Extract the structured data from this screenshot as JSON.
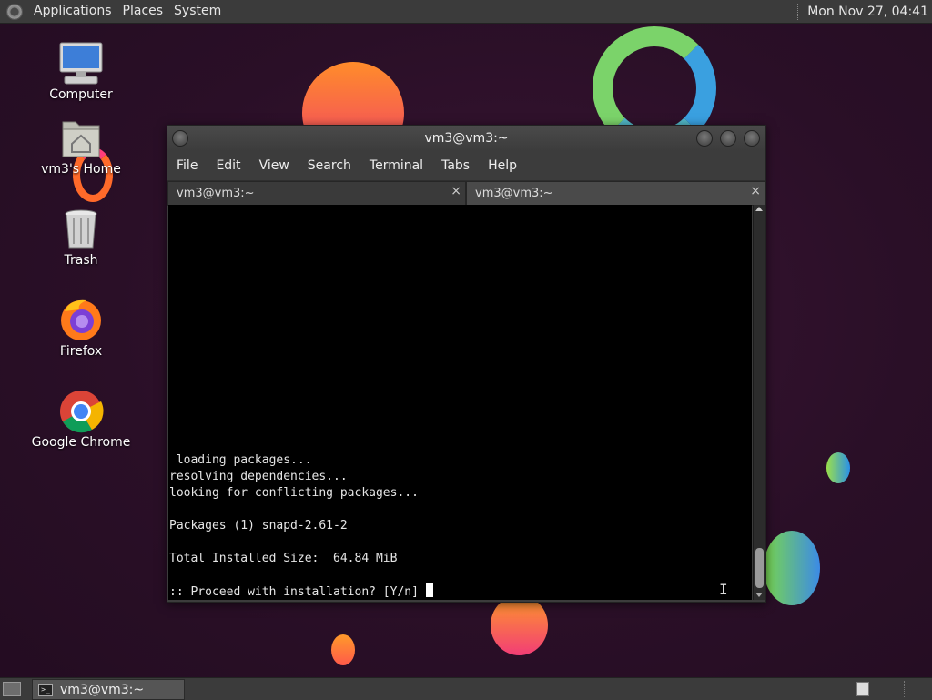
{
  "top_panel": {
    "menus": [
      "Applications",
      "Places",
      "System"
    ],
    "clock": "Mon Nov 27, 04:41"
  },
  "desktop": {
    "icons": [
      {
        "label": "Computer",
        "icon": "computer-icon"
      },
      {
        "label": "vm3's Home",
        "icon": "home-folder-icon"
      },
      {
        "label": "Trash",
        "icon": "trash-icon"
      },
      {
        "label": "Firefox",
        "icon": "firefox-icon"
      },
      {
        "label": "Google Chrome",
        "icon": "chrome-icon"
      }
    ]
  },
  "window": {
    "title": "vm3@vm3:~",
    "menu": [
      "File",
      "Edit",
      "View",
      "Search",
      "Terminal",
      "Tabs",
      "Help"
    ],
    "tabs": [
      {
        "label": "vm3@vm3:~",
        "close": "×"
      },
      {
        "label": "vm3@vm3:~",
        "close": "×"
      }
    ],
    "terminal_lines": [
      " loading packages...",
      "resolving dependencies...",
      "looking for conflicting packages...",
      "",
      "Packages (1) snapd-2.61-2",
      "",
      "Total Installed Size:  64.84 MiB",
      "",
      ":: Proceed with installation? [Y/n] "
    ]
  },
  "taskbar": {
    "task_label": "vm3@vm3:~"
  },
  "colors": {
    "panel": "#3b3b3b",
    "wallpaper": "#2a0f27",
    "terminal_bg": "#000000",
    "terminal_fg": "#e6e6e6"
  }
}
